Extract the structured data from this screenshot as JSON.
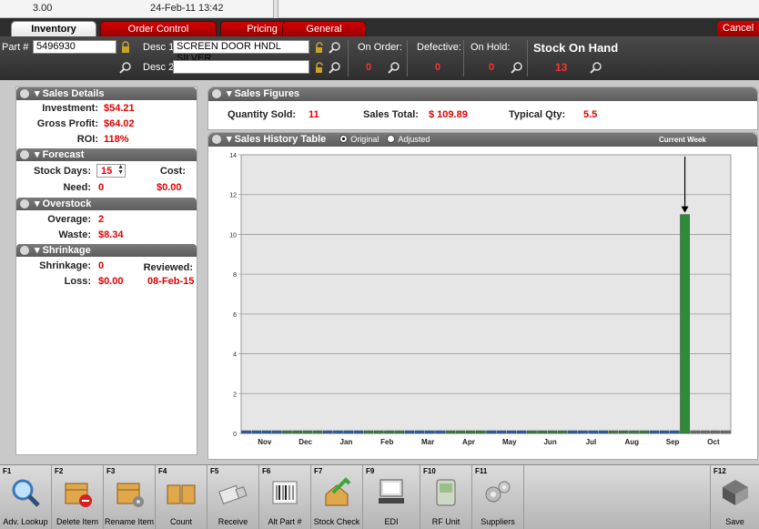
{
  "background": {
    "value": "3.00",
    "date": "24-Feb-11 13:42"
  },
  "tabs": [
    "Inventory",
    "Order Control",
    "Pricing",
    "General"
  ],
  "cancel_label": "Cancel",
  "header": {
    "part_label": "Part #",
    "part_value": "5496930",
    "desc1_label": "Desc 1",
    "desc1_value": "SCREEN DOOR HNDL SILVER",
    "desc2_label": "Desc 2",
    "desc2_value": "",
    "on_order_label": "On Order:",
    "on_order_value": "0",
    "defective_label": "Defective:",
    "defective_value": "0",
    "on_hold_label": "On Hold:",
    "on_hold_value": "0",
    "stock_label": "Stock On Hand",
    "stock_value": "13"
  },
  "sales_details": {
    "title": "Sales Details",
    "investment_label": "Investment:",
    "investment_value": "$54.21",
    "gross_profit_label": "Gross Profit:",
    "gross_profit_value": "$64.02",
    "roi_label": "ROI:",
    "roi_value": "118%"
  },
  "forecast": {
    "title": "Forecast",
    "stock_days_label": "Stock Days:",
    "stock_days_value": "15",
    "cost_label": "Cost:",
    "cost_value": "$0.00",
    "need_label": "Need:",
    "need_value": "0"
  },
  "overstock": {
    "title": "Overstock",
    "overage_label": "Overage:",
    "overage_value": "2",
    "waste_label": "Waste:",
    "waste_value": "$8.34"
  },
  "shrinkage": {
    "title": "Shrinkage",
    "shrinkage_label": "Shrinkage:",
    "shrinkage_value": "0",
    "reviewed_label": "Reviewed:",
    "reviewed_value": "08-Feb-15",
    "loss_label": "Loss:",
    "loss_value": "$0.00"
  },
  "sales_figures": {
    "title": "Sales Figures",
    "qty_sold_label": "Quantity Sold:",
    "qty_sold_value": "11",
    "sales_total_label": "Sales Total:",
    "sales_total_value": "$ 109.89",
    "typical_qty_label": "Typical Qty:",
    "typical_qty_value": "5.5"
  },
  "history": {
    "title": "Sales History Table",
    "original_label": "Original",
    "adjusted_label": "Adjusted",
    "current_week_label": "Current Week"
  },
  "chart_data": {
    "type": "bar",
    "categories": [
      "Nov",
      "Dec",
      "Jan",
      "Feb",
      "Mar",
      "Apr",
      "May",
      "Jun",
      "Jul",
      "Aug",
      "Sep",
      "Oct"
    ],
    "weekly_values": [
      0,
      0,
      0,
      0,
      0,
      0,
      0,
      0,
      0,
      0,
      0,
      0,
      0,
      0,
      0,
      0,
      0,
      0,
      0,
      0,
      0,
      0,
      0,
      0,
      0,
      0,
      0,
      0,
      0,
      0,
      0,
      0,
      0,
      0,
      0,
      0,
      0,
      0,
      0,
      0,
      0,
      0,
      0,
      11,
      0,
      0,
      0,
      0
    ],
    "current_week_index": 43,
    "yticks": [
      0,
      2,
      4,
      6,
      8,
      10,
      12,
      14
    ],
    "ylim": [
      0,
      14
    ],
    "colors": {
      "normal": "#2b5fa8",
      "alt": "#3f7d46",
      "current": "#2f8a3a",
      "future": "#707070",
      "plot_bg": "#e6e6e6"
    }
  },
  "toolbar": [
    {
      "key": "F1",
      "label": "Adv. Lookup",
      "icon": "magnifier-icon"
    },
    {
      "key": "F2",
      "label": "Delete Item",
      "icon": "delete-box-icon"
    },
    {
      "key": "F3",
      "label": "Rename Item",
      "icon": "rename-box-icon"
    },
    {
      "key": "F4",
      "label": "Count",
      "icon": "count-boxes-icon"
    },
    {
      "key": "F5",
      "label": "Receive",
      "icon": "truck-icon"
    },
    {
      "key": "F6",
      "label": "Alt Part #",
      "icon": "barcode-icon"
    },
    {
      "key": "F7",
      "label": "Stock Check",
      "icon": "stock-check-icon"
    },
    {
      "key": "F9",
      "label": "EDI",
      "icon": "computer-icon"
    },
    {
      "key": "F10",
      "label": "RF Unit",
      "icon": "rf-unit-icon"
    },
    {
      "key": "F11",
      "label": "Suppliers",
      "icon": "gears-icon"
    },
    {
      "key": "F12",
      "label": "Save",
      "icon": "save-disk-icon"
    }
  ]
}
